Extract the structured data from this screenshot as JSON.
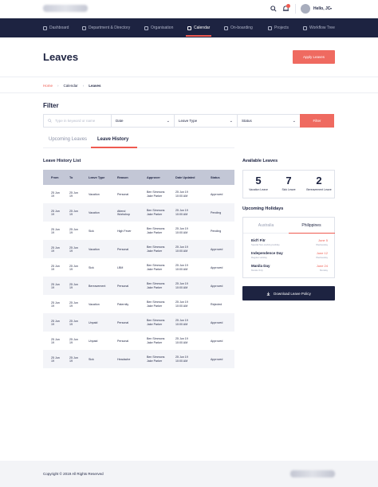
{
  "header": {
    "greeting": "Hello, JC",
    "icons": [
      "search-icon",
      "bell-icon",
      "chevron-down-icon"
    ]
  },
  "nav": {
    "items": [
      {
        "label": "Dashboard",
        "icon": "dashboard-icon"
      },
      {
        "label": "Department & Directory",
        "icon": "people-icon"
      },
      {
        "label": "Organisation",
        "icon": "org-icon"
      },
      {
        "label": "Calendar",
        "icon": "calendar-icon",
        "active": true
      },
      {
        "label": "On-boarding",
        "icon": "rocket-icon"
      },
      {
        "label": "Projects",
        "icon": "folder-icon"
      },
      {
        "label": "Workflow Tree",
        "icon": "tree-icon"
      }
    ]
  },
  "page": {
    "title": "Leaves",
    "apply_label": "Apply Leaves",
    "breadcrumb": {
      "home": "Home",
      "calendar": "Calendar",
      "current": "Leaves"
    }
  },
  "filter": {
    "title": "Filter",
    "search_placeholder": "Type in keyword or name",
    "date_label": "Date",
    "type_label": "Leave Type",
    "status_label": "Status",
    "button_label": "Filter"
  },
  "tabs": {
    "upcoming": "Upcoming Leaves",
    "history": "Leave History"
  },
  "history": {
    "title": "Leave History List",
    "columns": [
      "From",
      "To",
      "Leave Type",
      "Reason",
      "Approver",
      "Date Updated",
      "Status"
    ],
    "rows": [
      {
        "from": "25 Jun 19",
        "to": "25 Jun 19",
        "type": "Vacation",
        "reason": "Personal",
        "approver1": "Ben Simmons",
        "approver2": "Jake Parker",
        "date1": "25 Jun 19",
        "date2": "10:00 AM",
        "status": "Approved"
      },
      {
        "from": "25 Jun 19",
        "to": "25 Jun 19",
        "type": "Vacation",
        "reason": "Attend Workshop",
        "approver1": "Ben Simmons",
        "approver2": "Jake Parker",
        "date1": "25 Jun 19",
        "date2": "10:00 AM",
        "status": "Pending"
      },
      {
        "from": "25 Jun 19",
        "to": "25 Jun 19",
        "type": "Sick",
        "reason": "High Fever",
        "approver1": "Ben Simmons",
        "approver2": "Jake Parker",
        "date1": "25 Jun 19",
        "date2": "10:00 AM",
        "status": "Pending"
      },
      {
        "from": "25 Jun 19",
        "to": "25 Jun 19",
        "type": "Vacation",
        "reason": "Personal",
        "approver1": "Ben Simmons",
        "approver2": "Jake Parker",
        "date1": "25 Jun 19",
        "date2": "10:00 AM",
        "status": "Approved"
      },
      {
        "from": "25 Jun 19",
        "to": "25 Jun 19",
        "type": "Sick",
        "reason": "LBM",
        "approver1": "Ben Simmons",
        "approver2": "Jake Parker",
        "date1": "25 Jun 19",
        "date2": "10:00 AM",
        "status": "Approved"
      },
      {
        "from": "25 Jun 19",
        "to": "25 Jun 19",
        "type": "Bereavement",
        "reason": "Personal",
        "approver1": "Ben Simmons",
        "approver2": "Jake Parker",
        "date1": "25 Jun 19",
        "date2": "10:00 AM",
        "status": "Approved"
      },
      {
        "from": "25 Jun 19",
        "to": "25 Jun 19",
        "type": "Vacation",
        "reason": "Paternity",
        "approver1": "Ben Simmons",
        "approver2": "Jake Parker",
        "date1": "25 Jun 19",
        "date2": "10:00 AM",
        "status": "Rejected"
      },
      {
        "from": "25 Jun 19",
        "to": "25 Jun 19",
        "type": "Unpaid",
        "reason": "Personal",
        "approver1": "Ben Simmons",
        "approver2": "Jake Parker",
        "date1": "25 Jun 19",
        "date2": "10:00 AM",
        "status": "Approved"
      },
      {
        "from": "25 Jun 19",
        "to": "25 Jun 19",
        "type": "Unpaid",
        "reason": "Personal",
        "approver1": "Ben Simmons",
        "approver2": "Jake Parker",
        "date1": "25 Jun 19",
        "date2": "10:00 AM",
        "status": "Approved"
      },
      {
        "from": "25 Jun 19",
        "to": "25 Jun 19",
        "type": "Sick",
        "reason": "Headache",
        "approver1": "Ben Simmons",
        "approver2": "Jake Parker",
        "date1": "25 Jun 19",
        "date2": "10:00 AM",
        "status": "Approved"
      }
    ]
  },
  "available": {
    "title": "Available Leaves",
    "items": [
      {
        "num": "5",
        "label": "Vacation Leave"
      },
      {
        "num": "7",
        "label": "Sick Leave"
      },
      {
        "num": "2",
        "label": "Bereavement Leave"
      }
    ]
  },
  "holidays": {
    "title": "Upcoming Holidays",
    "tab_australia": "Australia",
    "tab_philippines": "Philippines",
    "items": [
      {
        "name": "Eid'l Fitr",
        "sub": "Special Non-working Holiday",
        "date": "June 5",
        "weekday": "Wednesday"
      },
      {
        "name": "Independence Day",
        "sub": "Regular Holiday",
        "date": "June 12",
        "weekday": "Wednesday"
      },
      {
        "name": "Manila Day",
        "sub": "Manila Only",
        "date": "June 24",
        "weekday": "Monday"
      }
    ]
  },
  "download": {
    "label": "Download Leave Policy",
    "icon": "download-icon"
  },
  "footer": {
    "copyright": "Copyright © 2019 All Rights Reserved"
  },
  "colors": {
    "navy": "#1d2341",
    "accent": "#ef5a50",
    "header_row": "#c3c7d6"
  }
}
